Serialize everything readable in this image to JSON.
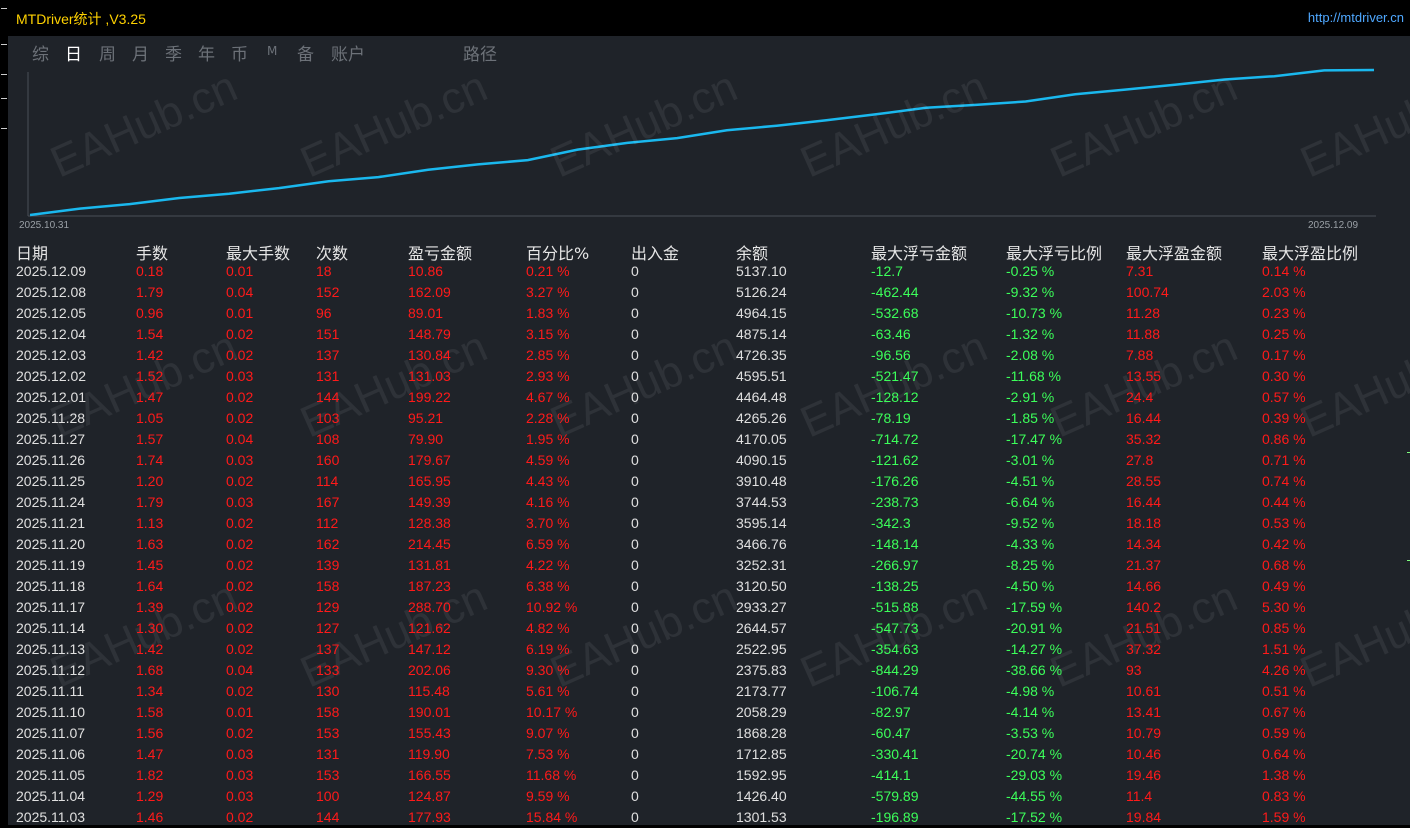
{
  "window": {
    "title": "MTDriver统计 ,V3.25",
    "url": "http://mtdriver.cn"
  },
  "tabs": [
    {
      "label": "综",
      "active": false
    },
    {
      "label": "日",
      "active": true
    },
    {
      "label": "周",
      "active": false
    },
    {
      "label": "月",
      "active": false
    },
    {
      "label": "季",
      "active": false
    },
    {
      "label": "年",
      "active": false
    },
    {
      "label": "币",
      "active": false
    },
    {
      "label": "M",
      "active": false
    },
    {
      "label": "备",
      "active": false
    },
    {
      "label": "账户",
      "active": false
    },
    {
      "label": "路径",
      "active": false
    }
  ],
  "watermark_text": "EAHub.cn",
  "chart_data": {
    "type": "line",
    "x_start_label": "2025.10.31",
    "x_end_label": "2025.12.09",
    "line_color": "#1ab8ee",
    "x": [
      "2025.10.31",
      "2025.11.03",
      "2025.11.04",
      "2025.11.05",
      "2025.11.06",
      "2025.11.07",
      "2025.11.10",
      "2025.11.11",
      "2025.11.12",
      "2025.11.13",
      "2025.11.14",
      "2025.11.17",
      "2025.11.18",
      "2025.11.19",
      "2025.11.20",
      "2025.11.21",
      "2025.11.24",
      "2025.11.25",
      "2025.11.26",
      "2025.11.27",
      "2025.11.28",
      "2025.12.01",
      "2025.12.02",
      "2025.12.03",
      "2025.12.04",
      "2025.12.05",
      "2025.12.08",
      "2025.12.09"
    ],
    "values": [
      1123.6,
      1301.53,
      1426.4,
      1592.95,
      1712.85,
      1868.28,
      2058.29,
      2173.77,
      2375.83,
      2522.95,
      2644.57,
      2933.27,
      3120.5,
      3252.31,
      3466.76,
      3595.14,
      3744.53,
      3910.48,
      4090.15,
      4170.05,
      4265.26,
      4464.48,
      4595.51,
      4726.35,
      4875.14,
      4964.15,
      5126.24,
      5137.1
    ]
  },
  "table": {
    "columns": [
      "日期",
      "手数",
      "最大手数",
      "次数",
      "盈亏金额",
      "百分比%",
      "出入金",
      "余额",
      "最大浮亏金额",
      "最大浮亏比例",
      "最大浮盈金额",
      "最大浮盈比例"
    ],
    "rows": [
      [
        "2025.12.09",
        "0.18",
        "0.01",
        "18",
        "10.86",
        "0.21 %",
        "0",
        "5137.10",
        "-12.7",
        "-0.25 %",
        "7.31",
        "0.14 %"
      ],
      [
        "2025.12.08",
        "1.79",
        "0.04",
        "152",
        "162.09",
        "3.27 %",
        "0",
        "5126.24",
        "-462.44",
        "-9.32 %",
        "100.74",
        "2.03 %"
      ],
      [
        "2025.12.05",
        "0.96",
        "0.01",
        "96",
        "89.01",
        "1.83 %",
        "0",
        "4964.15",
        "-532.68",
        "-10.73 %",
        "11.28",
        "0.23 %"
      ],
      [
        "2025.12.04",
        "1.54",
        "0.02",
        "151",
        "148.79",
        "3.15 %",
        "0",
        "4875.14",
        "-63.46",
        "-1.32 %",
        "11.88",
        "0.25 %"
      ],
      [
        "2025.12.03",
        "1.42",
        "0.02",
        "137",
        "130.84",
        "2.85 %",
        "0",
        "4726.35",
        "-96.56",
        "-2.08 %",
        "7.88",
        "0.17 %"
      ],
      [
        "2025.12.02",
        "1.52",
        "0.03",
        "131",
        "131.03",
        "2.93 %",
        "0",
        "4595.51",
        "-521.47",
        "-11.68 %",
        "13.55",
        "0.30 %"
      ],
      [
        "2025.12.01",
        "1.47",
        "0.02",
        "144",
        "199.22",
        "4.67 %",
        "0",
        "4464.48",
        "-128.12",
        "-2.91 %",
        "24.4",
        "0.57 %"
      ],
      [
        "2025.11.28",
        "1.05",
        "0.02",
        "103",
        "95.21",
        "2.28 %",
        "0",
        "4265.26",
        "-78.19",
        "-1.85 %",
        "16.44",
        "0.39 %"
      ],
      [
        "2025.11.27",
        "1.57",
        "0.04",
        "108",
        "79.90",
        "1.95 %",
        "0",
        "4170.05",
        "-714.72",
        "-17.47 %",
        "35.32",
        "0.86 %"
      ],
      [
        "2025.11.26",
        "1.74",
        "0.03",
        "160",
        "179.67",
        "4.59 %",
        "0",
        "4090.15",
        "-121.62",
        "-3.01 %",
        "27.8",
        "0.71 %"
      ],
      [
        "2025.11.25",
        "1.20",
        "0.02",
        "114",
        "165.95",
        "4.43 %",
        "0",
        "3910.48",
        "-176.26",
        "-4.51 %",
        "28.55",
        "0.74 %"
      ],
      [
        "2025.11.24",
        "1.79",
        "0.03",
        "167",
        "149.39",
        "4.16 %",
        "0",
        "3744.53",
        "-238.73",
        "-6.64 %",
        "16.44",
        "0.44 %"
      ],
      [
        "2025.11.21",
        "1.13",
        "0.02",
        "112",
        "128.38",
        "3.70 %",
        "0",
        "3595.14",
        "-342.3",
        "-9.52 %",
        "18.18",
        "0.53 %"
      ],
      [
        "2025.11.20",
        "1.63",
        "0.02",
        "162",
        "214.45",
        "6.59 %",
        "0",
        "3466.76",
        "-148.14",
        "-4.33 %",
        "14.34",
        "0.42 %"
      ],
      [
        "2025.11.19",
        "1.45",
        "0.02",
        "139",
        "131.81",
        "4.22 %",
        "0",
        "3252.31",
        "-266.97",
        "-8.25 %",
        "21.37",
        "0.68 %"
      ],
      [
        "2025.11.18",
        "1.64",
        "0.02",
        "158",
        "187.23",
        "6.38 %",
        "0",
        "3120.50",
        "-138.25",
        "-4.50 %",
        "14.66",
        "0.49 %"
      ],
      [
        "2025.11.17",
        "1.39",
        "0.02",
        "129",
        "288.70",
        "10.92 %",
        "0",
        "2933.27",
        "-515.88",
        "-17.59 %",
        "140.2",
        "5.30 %"
      ],
      [
        "2025.11.14",
        "1.30",
        "0.02",
        "127",
        "121.62",
        "4.82 %",
        "0",
        "2644.57",
        "-547.73",
        "-20.91 %",
        "21.51",
        "0.85 %"
      ],
      [
        "2025.11.13",
        "1.42",
        "0.02",
        "137",
        "147.12",
        "6.19 %",
        "0",
        "2522.95",
        "-354.63",
        "-14.27 %",
        "37.32",
        "1.51 %"
      ],
      [
        "2025.11.12",
        "1.68",
        "0.04",
        "133",
        "202.06",
        "9.30 %",
        "0",
        "2375.83",
        "-844.29",
        "-38.66 %",
        "93",
        "4.26 %"
      ],
      [
        "2025.11.11",
        "1.34",
        "0.02",
        "130",
        "115.48",
        "5.61 %",
        "0",
        "2173.77",
        "-106.74",
        "-4.98 %",
        "10.61",
        "0.51 %"
      ],
      [
        "2025.11.10",
        "1.58",
        "0.01",
        "158",
        "190.01",
        "10.17 %",
        "0",
        "2058.29",
        "-82.97",
        "-4.14 %",
        "13.41",
        "0.67 %"
      ],
      [
        "2025.11.07",
        "1.56",
        "0.02",
        "153",
        "155.43",
        "9.07 %",
        "0",
        "1868.28",
        "-60.47",
        "-3.53 %",
        "10.79",
        "0.59 %"
      ],
      [
        "2025.11.06",
        "1.47",
        "0.03",
        "131",
        "119.90",
        "7.53 %",
        "0",
        "1712.85",
        "-330.41",
        "-20.74 %",
        "10.46",
        "0.64 %"
      ],
      [
        "2025.11.05",
        "1.82",
        "0.03",
        "153",
        "166.55",
        "11.68 %",
        "0",
        "1592.95",
        "-414.1",
        "-29.03 %",
        "19.46",
        "1.38 %"
      ],
      [
        "2025.11.04",
        "1.29",
        "0.03",
        "100",
        "124.87",
        "9.59 %",
        "0",
        "1426.40",
        "-579.89",
        "-44.55 %",
        "11.4",
        "0.83 %"
      ],
      [
        "2025.11.03",
        "1.46",
        "0.02",
        "144",
        "177.93",
        "15.84 %",
        "0",
        "1301.53",
        "-196.89",
        "-17.52 %",
        "19.84",
        "1.59 %"
      ]
    ]
  }
}
